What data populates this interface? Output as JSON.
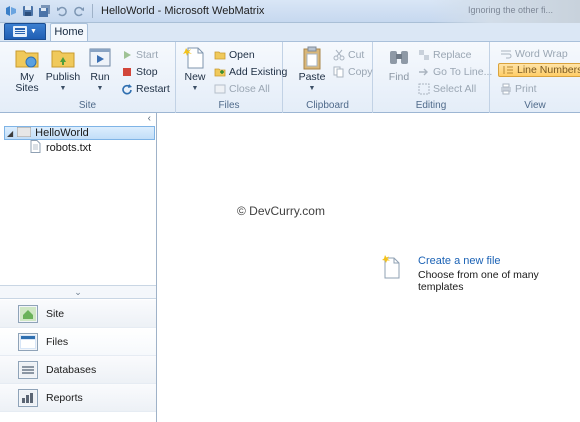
{
  "window": {
    "title": "HelloWorld - Microsoft WebMatrix",
    "background_peek_text": "Ignoring the other fi..."
  },
  "quick_access": {
    "icons": [
      "app-icon",
      "save-icon",
      "save-all-icon",
      "undo-icon",
      "redo-icon"
    ]
  },
  "tabs": {
    "home_label": "Home",
    "app_menu_icon": "app-menu-icon"
  },
  "ribbon": {
    "site": {
      "label": "Site",
      "my_sites": "My\nSites",
      "publish": "Publish",
      "run": "Run",
      "start": "Start",
      "stop": "Stop",
      "restart": "Restart"
    },
    "files": {
      "label": "Files",
      "new": "New",
      "open": "Open",
      "add_existing": "Add Existing",
      "close_all": "Close All"
    },
    "clipboard": {
      "label": "Clipboard",
      "paste": "Paste",
      "cut": "Cut",
      "copy": "Copy"
    },
    "editing": {
      "label": "Editing",
      "find": "Find",
      "replace": "Replace",
      "go_to_line": "Go To Line...",
      "select_all": "Select All"
    },
    "view": {
      "label": "View",
      "word_wrap": "Word Wrap",
      "line_numbers": "Line Numbers",
      "print": "Print"
    }
  },
  "tree": {
    "root": "HelloWorld",
    "children": [
      "robots.txt"
    ]
  },
  "nav": {
    "items": [
      "Site",
      "Files",
      "Databases",
      "Reports"
    ],
    "active": "Files"
  },
  "main": {
    "watermark": "© DevCurry.com",
    "create_link": "Create a new file",
    "create_subtitle": "Choose from one of many templates"
  },
  "colors": {
    "accent": "#1b62b5",
    "selection": "#c2def8",
    "highlight": "#ffcd67"
  }
}
